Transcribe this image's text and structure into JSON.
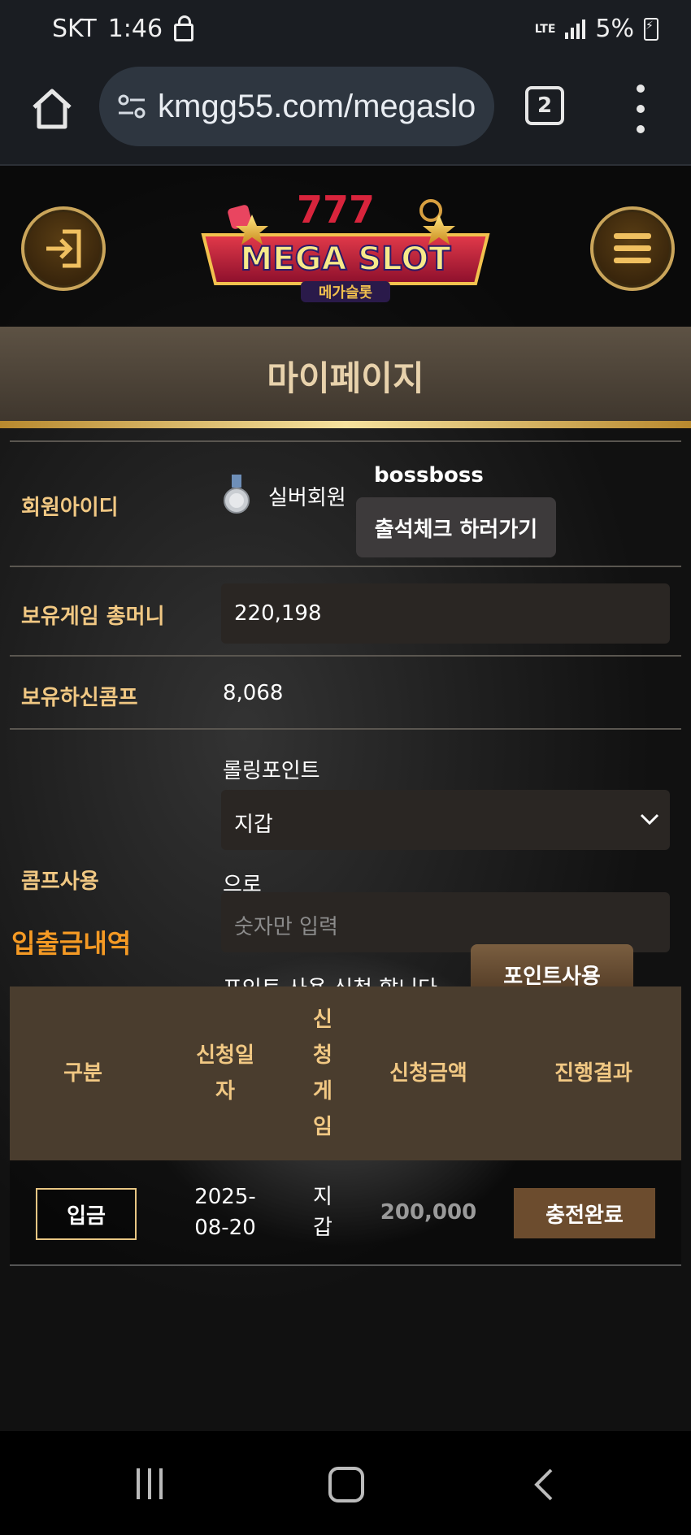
{
  "status_bar": {
    "carrier": "SKT",
    "time": "1:46",
    "network": "LTE",
    "battery": "5%"
  },
  "browser": {
    "url": "kmgg55.com/megaslo",
    "tab_count": "2"
  },
  "site": {
    "logo_text": "MEGA SLOT",
    "logo_sub": "메가슬롯",
    "page_title": "마이페이지"
  },
  "member": {
    "id_label": "회원아이디",
    "grade": "실버회원",
    "username": "bossboss",
    "attendance_button": "출석체크 하러가기",
    "money_label": "보유게임 총머니",
    "money_value": "220,198",
    "comp_label": "보유하신콤프",
    "comp_value": "8,068",
    "use_label": "콤프사용",
    "rolling_label": "롤링포인트",
    "wallet_option": "지갑",
    "to_text": "으로",
    "amount_placeholder": "숫자만 입력",
    "apply_text": "포인트 사용 신청 합니다.",
    "use_button": "포인트사용"
  },
  "history": {
    "title": "입출금내역",
    "columns": [
      "구분",
      "신청일\n자",
      "신\n청\n게\n임",
      "신청금액",
      "진행결과"
    ],
    "rows": [
      {
        "type": "입금",
        "date": "2025-\n08-20",
        "game": "지\n갑",
        "amount": "200,000",
        "status": "충전완료"
      }
    ]
  },
  "colors": {
    "accent_gold": "#f1c883",
    "section_orange": "#f59a24"
  }
}
